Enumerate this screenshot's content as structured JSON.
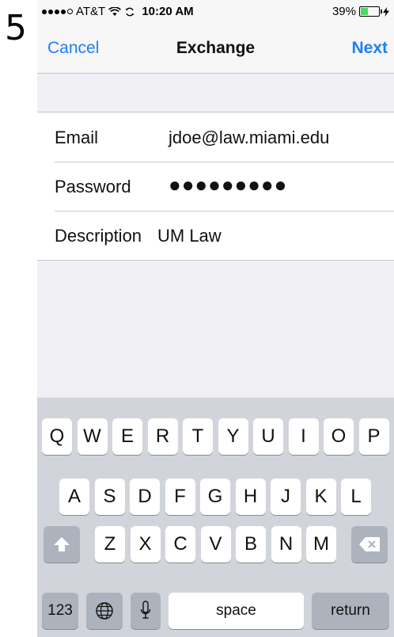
{
  "step_number": "5",
  "status_bar": {
    "carrier": "AT&T",
    "time": "10:20 AM",
    "battery": "39%",
    "battery_level": 0.39
  },
  "nav": {
    "cancel_label": "Cancel",
    "title": "Exchange",
    "next_label": "Next"
  },
  "form": {
    "email_label": "Email",
    "email_value": "jdoe@law.miami.edu",
    "password_label": "Password",
    "password_value": "●●●●●●●●●",
    "description_label": "Description",
    "description_value": "UM Law"
  },
  "keyboard": {
    "row1": [
      "Q",
      "W",
      "E",
      "R",
      "T",
      "Y",
      "U",
      "I",
      "O",
      "P"
    ],
    "row2": [
      "A",
      "S",
      "D",
      "F",
      "G",
      "H",
      "J",
      "K",
      "L"
    ],
    "row3": [
      "Z",
      "X",
      "C",
      "V",
      "B",
      "N",
      "M"
    ],
    "numbers_label": "123",
    "space_label": "space",
    "return_label": "return"
  },
  "icons": {
    "shift": "shift-icon",
    "backspace": "backspace-icon",
    "globe": "globe-icon",
    "mic": "microphone-icon",
    "wifi": "wifi-icon",
    "sync": "sync-icon",
    "charging": "charging-bolt-icon"
  }
}
